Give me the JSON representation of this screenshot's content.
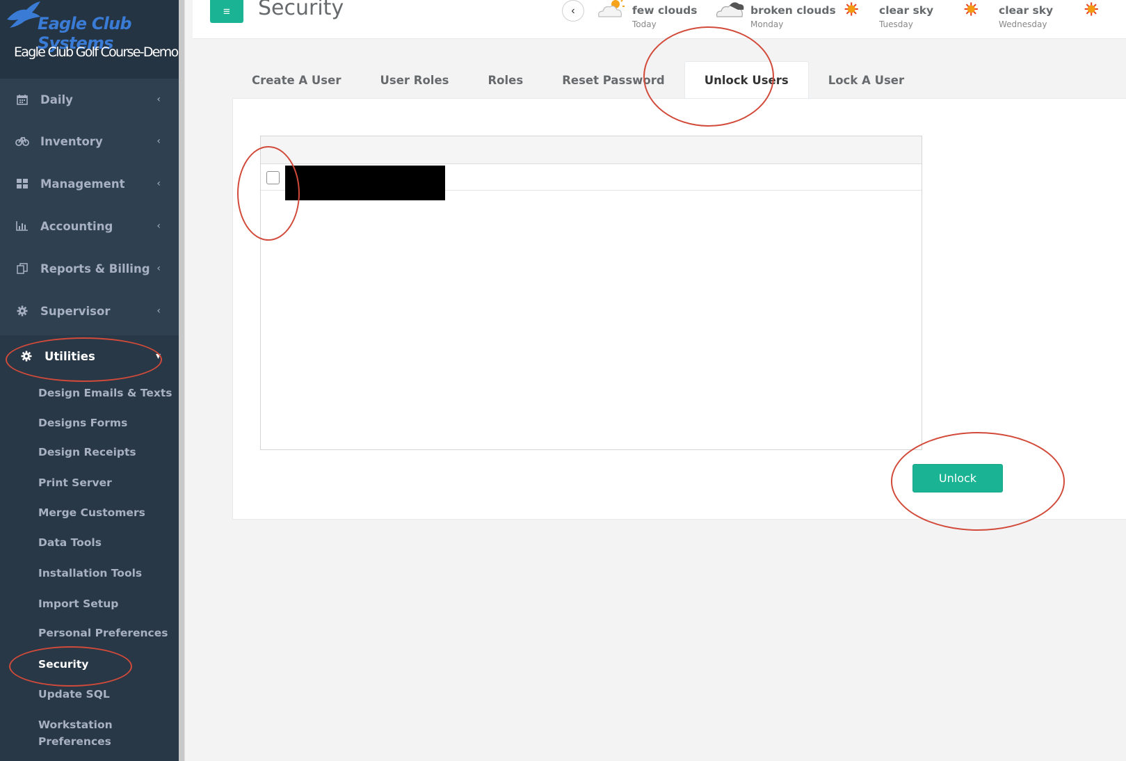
{
  "brand": {
    "logo_text": "Eagle Club Systems",
    "subtitle": "Eagle Club Golf Course-Demo"
  },
  "sidebar": {
    "items": [
      {
        "label": "Daily",
        "icon": "calendar-icon"
      },
      {
        "label": "Inventory",
        "icon": "bicycle-icon"
      },
      {
        "label": "Management",
        "icon": "grid-icon"
      },
      {
        "label": "Accounting",
        "icon": "bar-chart-icon"
      },
      {
        "label": "Reports & Billing",
        "icon": "copy-icon"
      },
      {
        "label": "Supervisor",
        "icon": "gear-icon"
      },
      {
        "label": "Utilities",
        "icon": "gear-icon"
      }
    ],
    "chevron": "‹",
    "subitems": [
      "Design Emails & Texts",
      "Designs Forms",
      "Design Receipts",
      "Print Server",
      "Merge Customers",
      "Data Tools",
      "Installation Tools",
      "Import Setup",
      "Personal Preferences",
      "Security",
      "Update SQL",
      "Workstation Preferences"
    ],
    "active_subitem": "Security"
  },
  "header": {
    "title": "Security",
    "menu_icon": "≡",
    "prev_icon": "‹"
  },
  "weather": [
    {
      "desc": "few clouds",
      "day": "Today",
      "icon": "partly-cloudy-icon"
    },
    {
      "desc": "broken clouds",
      "day": "Monday",
      "icon": "cloud-icon"
    },
    {
      "desc": "clear sky",
      "day": "Tuesday",
      "icon": "sun-icon"
    },
    {
      "desc": "clear sky",
      "day": "Wednesday",
      "icon": "sun-icon"
    },
    {
      "desc": "",
      "day": "",
      "icon": "sun-icon"
    }
  ],
  "tabs": [
    {
      "label": "Create A User"
    },
    {
      "label": "User Roles"
    },
    {
      "label": "Roles"
    },
    {
      "label": "Reset Password"
    },
    {
      "label": "Unlock Users",
      "active": true
    },
    {
      "label": "Lock A User"
    }
  ],
  "unlock": {
    "button_label": "Unlock",
    "rows": [
      {
        "checked": false
      }
    ]
  },
  "colors": {
    "accent": "#1ab394",
    "sidebar": "#2f4050",
    "annotation": "#d24a3a"
  }
}
